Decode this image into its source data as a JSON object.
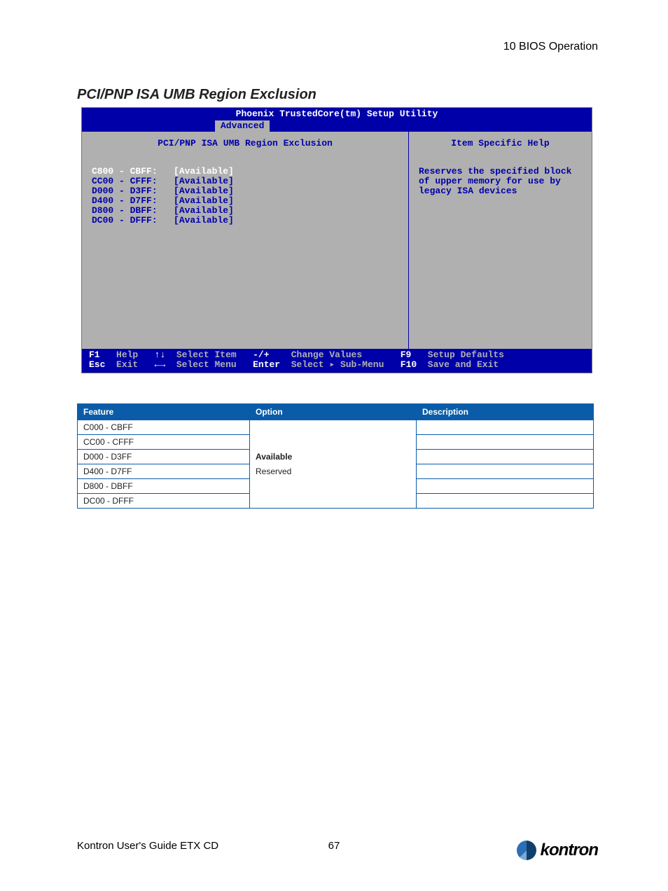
{
  "header": {
    "chapter": "10 BIOS Operation"
  },
  "section_title": "PCI/PNP ISA UMB Region Exclusion",
  "bios": {
    "title": "Phoenix TrustedCore(tm) Setup Utility",
    "menu_active": "Advanced",
    "panel_title": "PCI/PNP ISA UMB Region Exclusion",
    "help_title": "Item Specific Help",
    "help_text": "Reserves the specified block of upper memory for use by legacy ISA devices",
    "rows": [
      {
        "range": "C800 - CBFF:",
        "value": "[Available]",
        "highlighted": true
      },
      {
        "range": "CC00 - CFFF:",
        "value": "[Available]",
        "highlighted": false
      },
      {
        "range": "D000 - D3FF:",
        "value": "[Available]",
        "highlighted": false
      },
      {
        "range": "D400 - D7FF:",
        "value": "[Available]",
        "highlighted": false
      },
      {
        "range": "D800 - DBFF:",
        "value": "[Available]",
        "highlighted": false
      },
      {
        "range": "DC00 - DFFF:",
        "value": "[Available]",
        "highlighted": false
      }
    ],
    "footer": {
      "f1": "F1",
      "help": "Help",
      "arrows_ud": "↑↓",
      "select_item": "Select Item",
      "pm": "-/+",
      "change_values": "Change Values",
      "f9": "F9",
      "setup_defaults": "Setup Defaults",
      "esc": "Esc",
      "exit": "Exit",
      "arrows_lr": "←→",
      "select_menu": "Select Menu",
      "enter": "Enter",
      "select_submenu": "Select ▸ Sub-Menu",
      "f10": "F10",
      "save_exit": "Save and Exit"
    }
  },
  "table": {
    "headers": {
      "feature": "Feature",
      "option": "Option",
      "description": "Description"
    },
    "features": [
      "C000 - CBFF",
      "CC00 - CFFF",
      "D000 - D3FF",
      "D400 - D7FF",
      "D800 - DBFF",
      "DC00 - DFFF"
    ],
    "options": {
      "bold": "Available",
      "plain": "Reserved"
    }
  },
  "footer": {
    "guide": "Kontron User's Guide ETX CD",
    "page": "67",
    "brand": "kontron"
  }
}
